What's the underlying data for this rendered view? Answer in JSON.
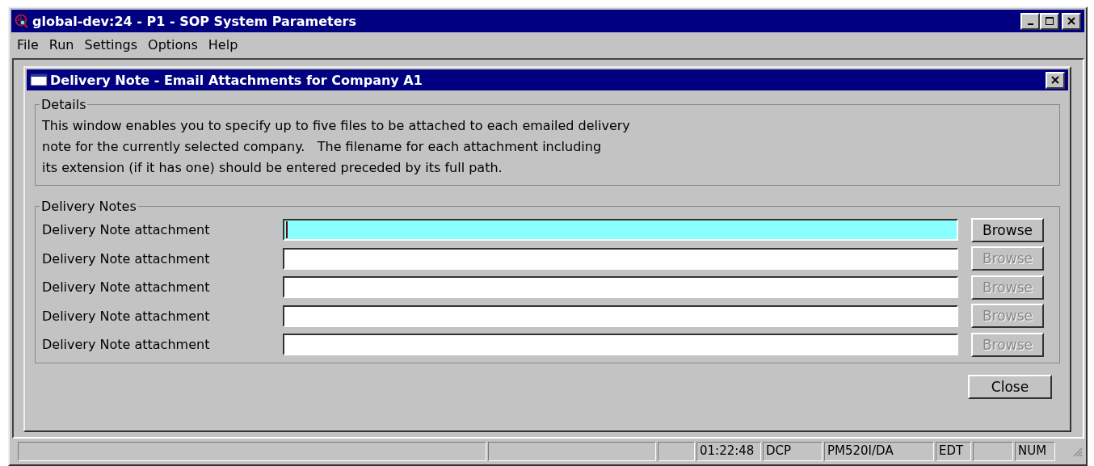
{
  "window": {
    "title": "global-dev:24 - P1 - SOP System Parameters"
  },
  "menu": [
    "File",
    "Run",
    "Settings",
    "Options",
    "Help"
  ],
  "dialog": {
    "title": "Delivery Note - Email Attachments for Company A1",
    "details": {
      "legend": "Details",
      "lines": [
        "This window enables you to specify up to five files to be attached to each emailed delivery",
        "note for the currently selected company.   The filename for each attachment including",
        "its extension (if it has one) should be entered preceded by its full path."
      ]
    },
    "attachments": {
      "legend": "Delivery Notes",
      "rows": [
        {
          "label": "Delivery Note attachment",
          "focused": true,
          "button": "Browse",
          "disabled": false
        },
        {
          "label": "Delivery Note attachment",
          "focused": false,
          "button": "Browse",
          "disabled": true
        },
        {
          "label": "Delivery Note attachment",
          "focused": false,
          "button": "Browse",
          "disabled": true
        },
        {
          "label": "Delivery Note attachment",
          "focused": false,
          "button": "Browse",
          "disabled": true
        },
        {
          "label": "Delivery Note attachment",
          "focused": false,
          "button": "Browse",
          "disabled": true
        }
      ]
    },
    "close_button": "Close"
  },
  "status_bar": [
    "01:22:48",
    "DCP",
    "PM520I/DA",
    "EDT",
    "NUM"
  ]
}
